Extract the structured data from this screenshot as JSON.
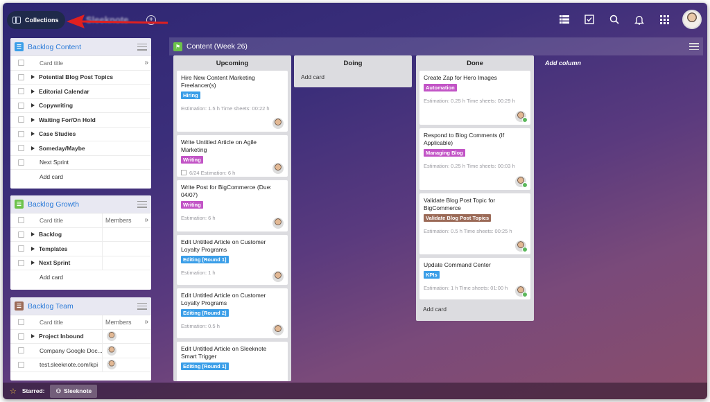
{
  "topbar": {
    "collections_label": "Collections",
    "org_name": "Sleeknote",
    "icons": [
      "list-view-icon",
      "checkbox-icon",
      "search-icon",
      "bell-icon",
      "apps-grid-icon"
    ]
  },
  "panels": [
    {
      "title": "Backlog Content",
      "color": "#3a9ee8",
      "header": {
        "title": "Card title"
      },
      "rows": [
        {
          "label": "Potential Blog Post Topics",
          "expand": true
        },
        {
          "label": "Editorial Calendar",
          "expand": true
        },
        {
          "label": "Copywriting",
          "expand": true
        },
        {
          "label": "Waiting For/On Hold",
          "expand": true
        },
        {
          "label": "Case Studies",
          "expand": true
        },
        {
          "label": "Someday/Maybe",
          "expand": true
        },
        {
          "label": "Next Sprint",
          "expand": false
        }
      ],
      "add_label": "Add card"
    },
    {
      "title": "Backlog Growth",
      "color": "#6cc24a",
      "header": {
        "title": "Card title",
        "members": "Members"
      },
      "rows": [
        {
          "label": "Backlog",
          "expand": true
        },
        {
          "label": "Templates",
          "expand": true
        },
        {
          "label": "Next Sprint",
          "expand": true
        }
      ],
      "add_label": "Add card"
    },
    {
      "title": "Backlog Team",
      "color": "#9b6a57",
      "header": {
        "title": "Card title",
        "members": "Members"
      },
      "rows": [
        {
          "label": "Project Inbound",
          "expand": true
        },
        {
          "label": "Company Google Doc...",
          "expand": false
        },
        {
          "label": "test.sleeknote.com/kpi",
          "expand": false
        }
      ]
    }
  ],
  "board": {
    "title": "Content (Week 26)",
    "add_column": "Add column",
    "columns": [
      {
        "title": "Upcoming",
        "cards": [
          {
            "title": "Hire New Content Marketing Freelancer(s)",
            "tag": "Hiring",
            "tag_color": "#3a9ee8",
            "meta": "Estimation: 1.5 h   Time sheets: 00:22 h"
          },
          {
            "title": "Write Untitled Article on Agile Marketing",
            "tag": "Writing",
            "tag_color": "#c254c6",
            "meta": "6/24   Estimation: 6 h",
            "check": true
          },
          {
            "title": "Write Post for BigCommerce (Due: 04/07)",
            "tag": "Writing",
            "tag_color": "#c254c6",
            "meta": "Estimation: 6 h"
          },
          {
            "title": "Edit Untitled Article on Customer Loyalty Programs",
            "tag": "Editing [Round 1]",
            "tag_color": "#3a9ee8",
            "meta": "Estimation: 1 h"
          },
          {
            "title": "Edit Untitled Article on Customer Loyalty Programs",
            "tag": "Editing [Round 2]",
            "tag_color": "#3a9ee8",
            "meta": "Estimation: 0.5 h"
          },
          {
            "title": "Edit Untitled Article on Sleeknote Smart Trigger",
            "tag": "Editing [Round 1]",
            "tag_color": "#3a9ee8",
            "meta": ""
          }
        ]
      },
      {
        "title": "Doing",
        "cards": [],
        "add_label": "Add card"
      },
      {
        "title": "Done",
        "cards": [
          {
            "title": "Create Zap for Hero Images",
            "tag": "Automation",
            "tag_color": "#c254c6",
            "meta": "Estimation: 0.25 h   Time sheets: 00:29 h"
          },
          {
            "title": "Respond to Blog Comments (If Applicable)",
            "tag": "Managing Blog",
            "tag_color": "#c254c6",
            "meta": "Estimation: 0.25 h   Time sheets: 00:03 h"
          },
          {
            "title": "Validate Blog Post Topic for BigCommerce",
            "tag": "Validate Blog Post Topics",
            "tag_color": "#9b6a57",
            "meta": "Estimation: 0.5 h   Time sheets: 00:25 h"
          },
          {
            "title": "Update Command Center",
            "tag": "KPIs",
            "tag_color": "#3a9ee8",
            "meta": "Estimation: 1 h   Time sheets: 01:00 h"
          }
        ],
        "add_label": "Add card"
      }
    ]
  },
  "bottombar": {
    "starred_label": "Starred:",
    "starred_item": "Sleeknote"
  }
}
